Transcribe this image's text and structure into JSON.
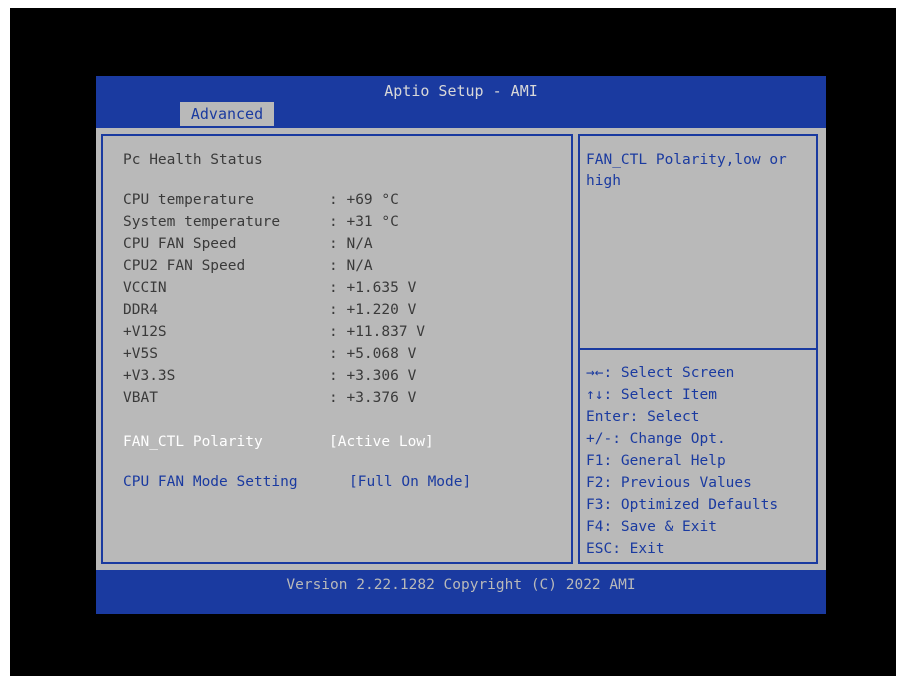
{
  "header": {
    "title": "Aptio Setup - AMI",
    "active_tab": "Advanced"
  },
  "page": {
    "title": "Pc Health Status"
  },
  "readings": [
    {
      "label": "CPU temperature",
      "value": ": +69 °C"
    },
    {
      "label": "System temperature",
      "value": ": +31 °C"
    },
    {
      "label": "CPU FAN Speed",
      "value": ": N/A"
    },
    {
      "label": "CPU2 FAN Speed",
      "value": ": N/A"
    },
    {
      "label": "VCCIN",
      "value": ": +1.635 V"
    },
    {
      "label": "DDR4",
      "value": ": +1.220 V"
    },
    {
      "label": "+V12S",
      "value": ": +11.837 V"
    },
    {
      "label": "+V5S",
      "value": ": +5.068 V"
    },
    {
      "label": "+V3.3S",
      "value": ": +3.306 V"
    },
    {
      "label": "VBAT",
      "value": ": +3.376 V"
    }
  ],
  "settings": [
    {
      "label": "FAN_CTL Polarity",
      "value": "[Active Low]",
      "selected": true
    },
    {
      "label": "CPU FAN Mode Setting",
      "value": "[Full On Mode]",
      "selected": false
    }
  ],
  "help": {
    "text": "FAN_CTL Polarity,low or high"
  },
  "keys": [
    "→←: Select Screen",
    "↑↓: Select Item",
    "Enter: Select",
    "+/-: Change Opt.",
    "F1: General Help",
    "F2: Previous Values",
    "F3: Optimized Defaults",
    "F4: Save & Exit",
    "ESC: Exit"
  ],
  "footer": {
    "version": "Version 2.22.1282 Copyright (C) 2022 AMI"
  },
  "colors": {
    "bar_blue": "#1a3aa0",
    "panel_gray": "#b9b9b9",
    "selected_text": "#ffffff"
  }
}
